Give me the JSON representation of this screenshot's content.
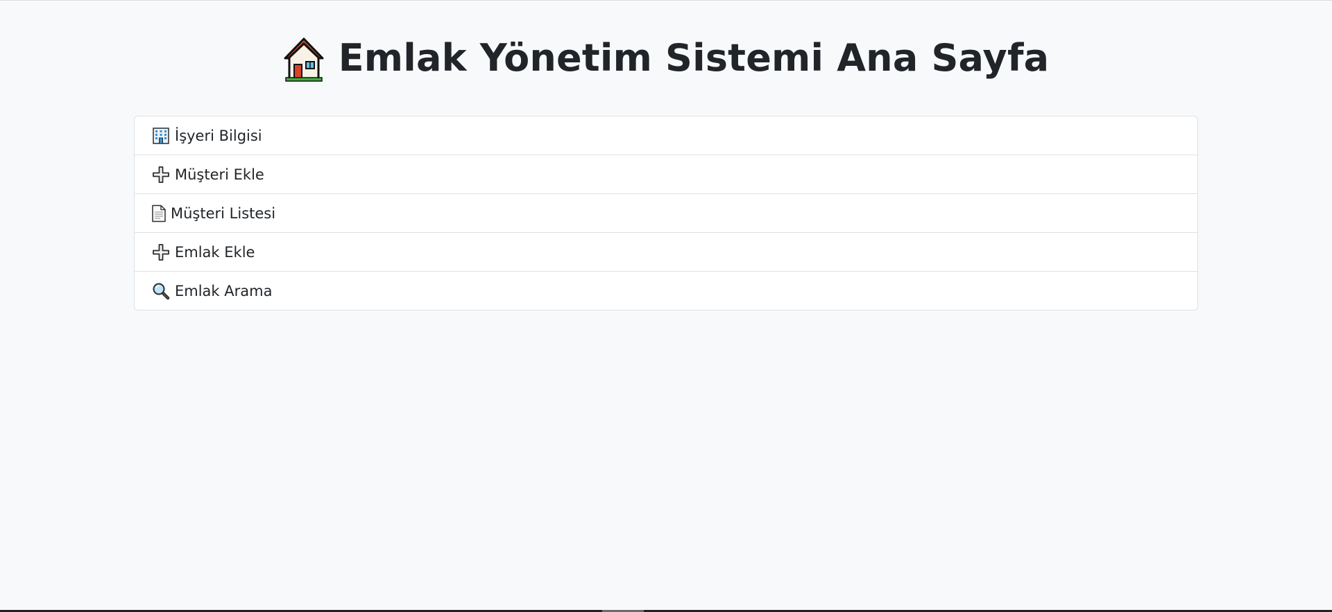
{
  "page": {
    "title": "Emlak Yönetim Sistemi Ana Sayfa",
    "title_icon": "house-icon"
  },
  "menu": {
    "items": [
      {
        "label": "İşyeri Bilgisi",
        "icon": "office-building-icon"
      },
      {
        "label": "Müşteri Ekle",
        "icon": "plus-icon"
      },
      {
        "label": "Müşteri Listesi",
        "icon": "document-icon"
      },
      {
        "label": "Emlak Ekle",
        "icon": "plus-icon"
      },
      {
        "label": "Emlak Arama",
        "icon": "magnifier-icon"
      }
    ]
  },
  "colors": {
    "background": "#f8f9fa",
    "text": "#212529",
    "border": "#dee2e6",
    "list_background": "#ffffff"
  }
}
